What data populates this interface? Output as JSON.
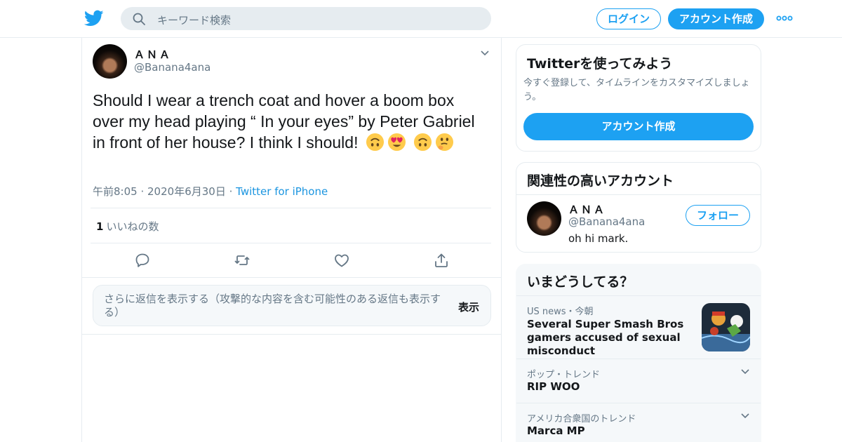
{
  "header": {
    "search_placeholder": "キーワード検索",
    "login_label": "ログイン",
    "signup_label": "アカウント作成"
  },
  "tweet": {
    "name": "ＡＮＡ",
    "handle": "@Banana4ana",
    "text": "Should I wear a trench coat and hover a boom box over my head playing “ In your eyes” by Peter Gabriel in front of her house? I think I should!",
    "emojis": [
      "upside-down-face",
      "heart-eyes-face",
      "upside-down-face",
      "thinking-face"
    ],
    "time": "午前8:05",
    "date": "2020年6月30日",
    "source": "Twitter for iPhone",
    "like_count": "1",
    "like_label": "いいねの数"
  },
  "more_replies": {
    "text": "さらに返信を表示する（攻撃的な内容を含む可能性のある返信も表示する）",
    "show_label": "表示"
  },
  "sidebar": {
    "join_card": {
      "title": "Twitterを使ってみよう",
      "desc": "今すぐ登録して、タイムラインをカスタマイズしましょう。",
      "cta": "アカウント作成"
    },
    "relevant": {
      "title": "関連性の高いアカウント",
      "name": "ＡＮＡ",
      "handle": "@Banana4ana",
      "bio": "oh hi mark.",
      "follow_label": "フォロー"
    },
    "trends": {
      "title": "いまどうしてる？",
      "items": [
        {
          "meta": "US news・今朝",
          "title": "Several Super Smash Bros gamers accused of sexual misconduct"
        },
        {
          "meta": "ポップ・トレンド",
          "title": "RIP WOO"
        },
        {
          "meta": "アメリカ合衆国のトレンド",
          "title": "Marca MP"
        }
      ]
    }
  },
  "colors": {
    "accent": "#1da1f2",
    "link": "#1b95e0",
    "secondary_text": "#657786",
    "border": "#e6ecf0"
  }
}
